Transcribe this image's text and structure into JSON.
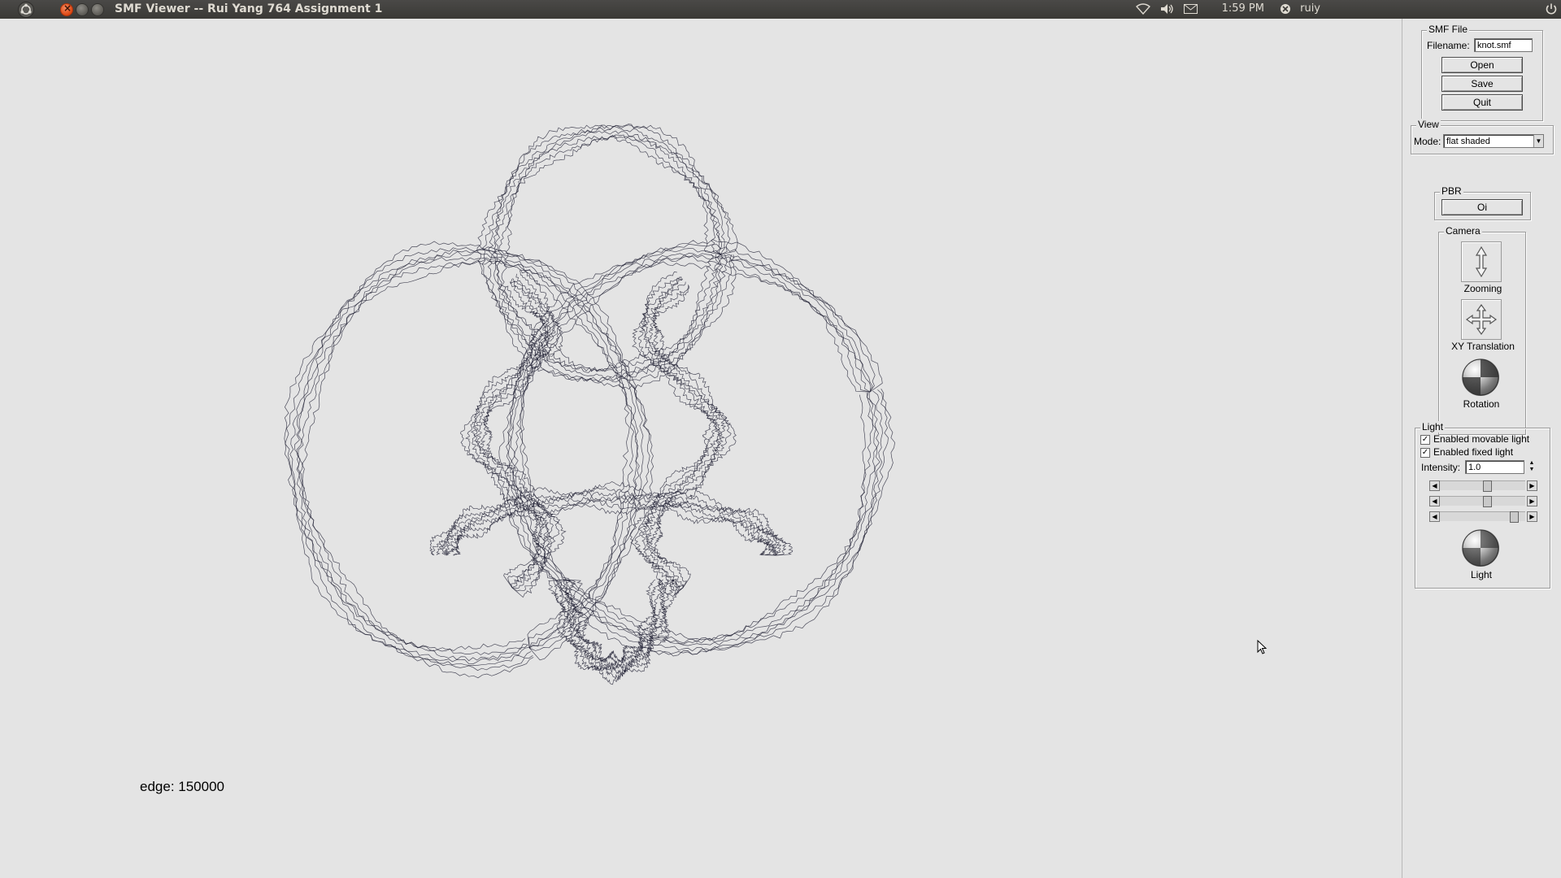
{
  "titlebar": {
    "title": "SMF Viewer -- Rui Yang 764 Assignment 1",
    "close_glyph": "×",
    "tray": {
      "time": "1:59 PM",
      "user": "ruiy"
    }
  },
  "viewport": {
    "edge_label": "edge: 150000",
    "background": "#e4e4e4",
    "mesh_color": "#1a1a2e"
  },
  "panel": {
    "smf_file": {
      "title": "SMF File",
      "filename_label": "Filename:",
      "filename_value": "knot.smf",
      "open_label": "Open",
      "save_label": "Save",
      "quit_label": "Quit"
    },
    "view": {
      "title": "View",
      "mode_label": "Mode:",
      "mode_value": "flat shaded"
    },
    "pbr": {
      "title": "PBR",
      "button_label": "Oi"
    },
    "camera": {
      "title": "Camera",
      "zooming_label": "Zooming",
      "translation_label": "XY Translation",
      "rotation_label": "Rotation"
    },
    "light": {
      "title": "Light",
      "movable_label": "Enabled movable light",
      "movable_checked": true,
      "fixed_label": "Enabled fixed light",
      "fixed_checked": true,
      "intensity_label": "Intensity:",
      "intensity_value": "1.0",
      "slider_levels": [
        0.55,
        0.55,
        0.9
      ],
      "light_label": "Light"
    }
  }
}
